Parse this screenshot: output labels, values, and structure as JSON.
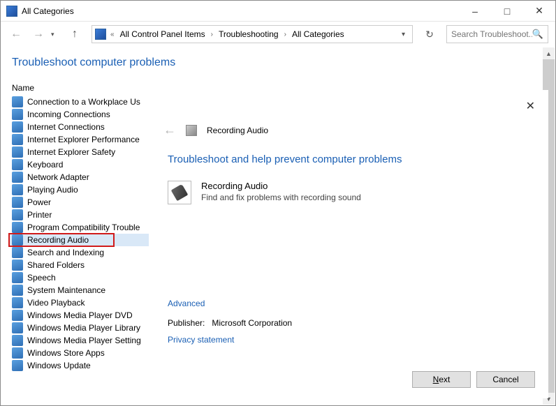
{
  "window": {
    "title": "All Categories"
  },
  "breadcrumb": {
    "back_chevron": "«",
    "seg1": "All Control Panel Items",
    "seg2": "Troubleshooting",
    "seg3": "All Categories"
  },
  "search": {
    "placeholder": "Search Troubleshoot..."
  },
  "heading": "Troubleshoot computer problems",
  "column_name": "Name",
  "items": [
    "Connection to a Workplace Us",
    "Incoming Connections",
    "Internet Connections",
    "Internet Explorer Performance",
    "Internet Explorer Safety",
    "Keyboard",
    "Network Adapter",
    "Playing Audio",
    "Power",
    "Printer",
    "Program Compatibility Trouble",
    "Recording Audio",
    "Search and Indexing",
    "Shared Folders",
    "Speech",
    "System Maintenance",
    "Video Playback",
    "Windows Media Player DVD",
    "Windows Media Player Library",
    "Windows Media Player Setting",
    "Windows Store Apps",
    "Windows Update"
  ],
  "selected_index": 11,
  "wizard": {
    "title": "Recording Audio",
    "heading": "Troubleshoot and help prevent computer problems",
    "item_title": "Recording Audio",
    "item_desc": "Find and fix problems with recording sound",
    "advanced": "Advanced",
    "publisher_label": "Publisher:",
    "publisher_value": "Microsoft Corporation",
    "privacy": "Privacy statement",
    "next": "Next",
    "next_underline": "N",
    "cancel": "Cancel"
  }
}
